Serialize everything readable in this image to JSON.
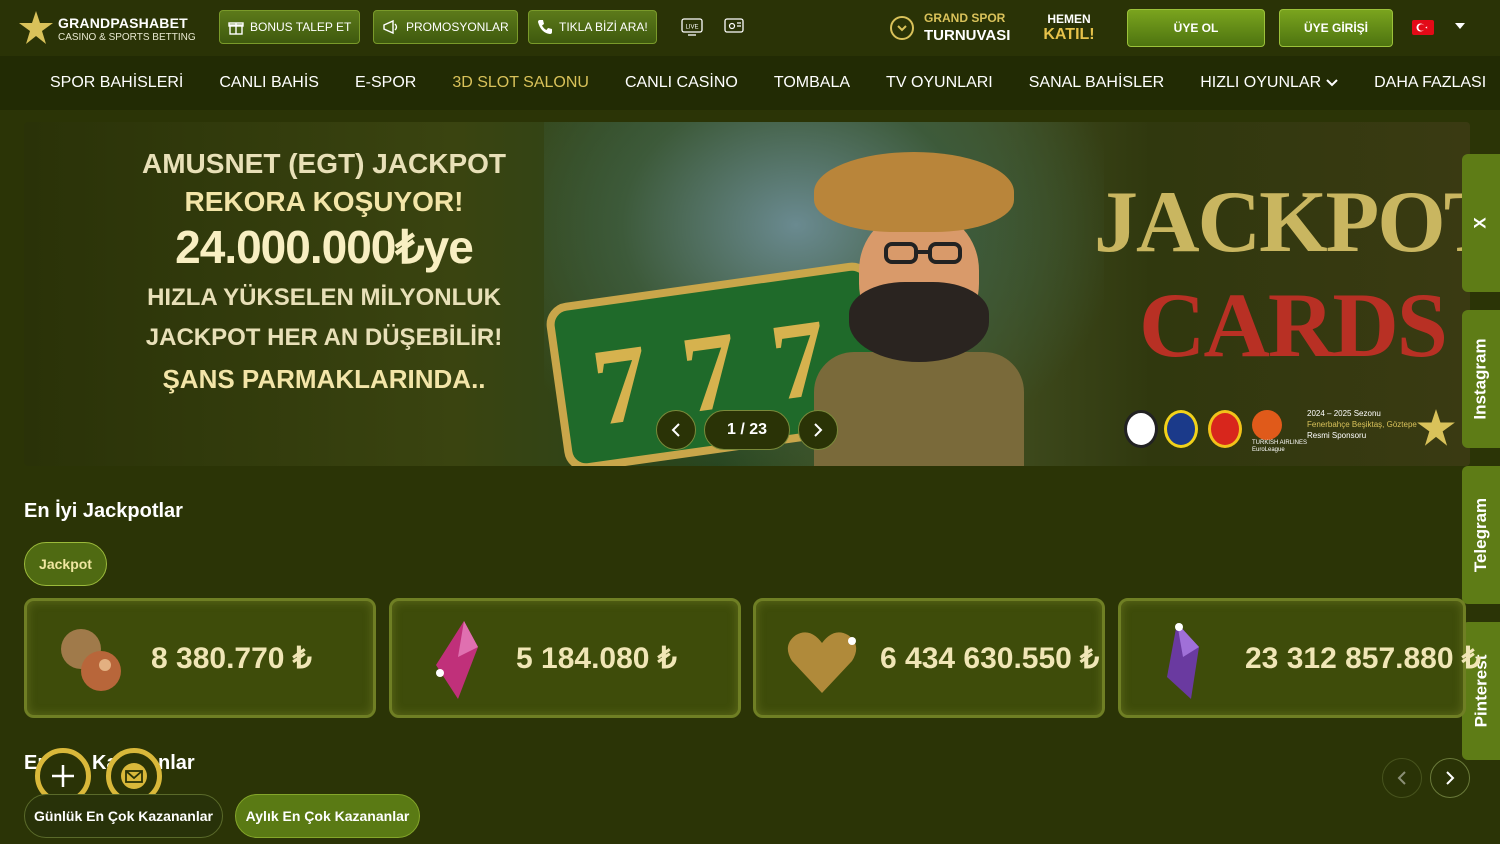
{
  "brand": {
    "name": "GRANDPASHABET",
    "tagline": "CASINO & SPORTS BETTING"
  },
  "topbar": {
    "bonus_label": "BONUS TALEP ET",
    "promos_label": "PROMOSYONLAR",
    "call_label": "TIKLA BİZİ ARA!",
    "live_icon": "live-tv-icon",
    "live_text": "LIVE",
    "chat_icon": "chat-icon",
    "grand_spor_line1": "GRAND SPOR",
    "grand_spor_line2": "TURNUVASI",
    "hemen_line1": "HEMEN",
    "hemen_line2": "KATIL!",
    "register_label": "ÜYE OL",
    "login_label": "ÜYE GİRİŞİ",
    "language_flag": "turkey-flag-icon"
  },
  "nav": {
    "items": [
      {
        "label": "SPOR BAHİSLERİ"
      },
      {
        "label": "CANLI BAHİS"
      },
      {
        "label": "E-SPOR"
      },
      {
        "label": "3D SLOT SALONU"
      },
      {
        "label": "CANLI CASİNO"
      },
      {
        "label": "TOMBALA"
      },
      {
        "label": "TV OYUNLARI"
      },
      {
        "label": "SANAL BAHİSLER"
      },
      {
        "label": "HIZLI OYUNLAR"
      },
      {
        "label": "DAHA FAZLASI"
      }
    ],
    "active_index": 3
  },
  "banner": {
    "line1": "AMUSNET (EGT) JACKPOT",
    "line2": "REKORA KOŞUYOR!",
    "line3": "24.000.000₺ye",
    "line4": "HIZLA YÜKSELEN MİLYONLUK",
    "line5": "JACKPOT HER AN DÜŞEBİLİR!",
    "line6": "ŞANS PARMAKLARINDA..",
    "game_title_1": "JACKPOT",
    "game_title_2": "CARDS",
    "sponsor_season": "2024 – 2025 Sezonu",
    "sponsor_teams": "Fenerbahçe Beşiktaş, Göztepe",
    "sponsor_official": "Resmi Sponsoru",
    "sponsor_airline": "TURKISH AIRLINES",
    "sponsor_league": "EuroLeague",
    "slide_counter": "1 / 23",
    "current_slide": 1,
    "total_slides": 23
  },
  "social": {
    "x_label": "X",
    "instagram_label": "Instagram",
    "telegram_label": "Telegram",
    "pinterest_label": "Pinterest"
  },
  "jackpots": {
    "title": "En İyi Jackpotlar",
    "filter_label": "Jackpot",
    "cards": [
      {
        "value": "8 380.770 ₺",
        "icon": "coins-icon"
      },
      {
        "value": "5 184.080 ₺",
        "icon": "pink-gem-icon"
      },
      {
        "value": "6 434 630.550 ₺",
        "icon": "gold-heart-icon"
      },
      {
        "value": "23 312 857.880 ₺",
        "icon": "purple-gem-icon"
      }
    ]
  },
  "winners": {
    "title_visible_start": "En",
    "title_visible_mid": "Ka",
    "title_visible_end": "nlar",
    "daily_label": "Günlük En Çok Kazananlar",
    "monthly_label": "Aylık En Çok Kazananlar"
  },
  "colors": {
    "background": "#2b3406",
    "accent_gold": "#d9c25a",
    "button_green": "#5c7a1a",
    "flag_red": "#e30a17"
  }
}
